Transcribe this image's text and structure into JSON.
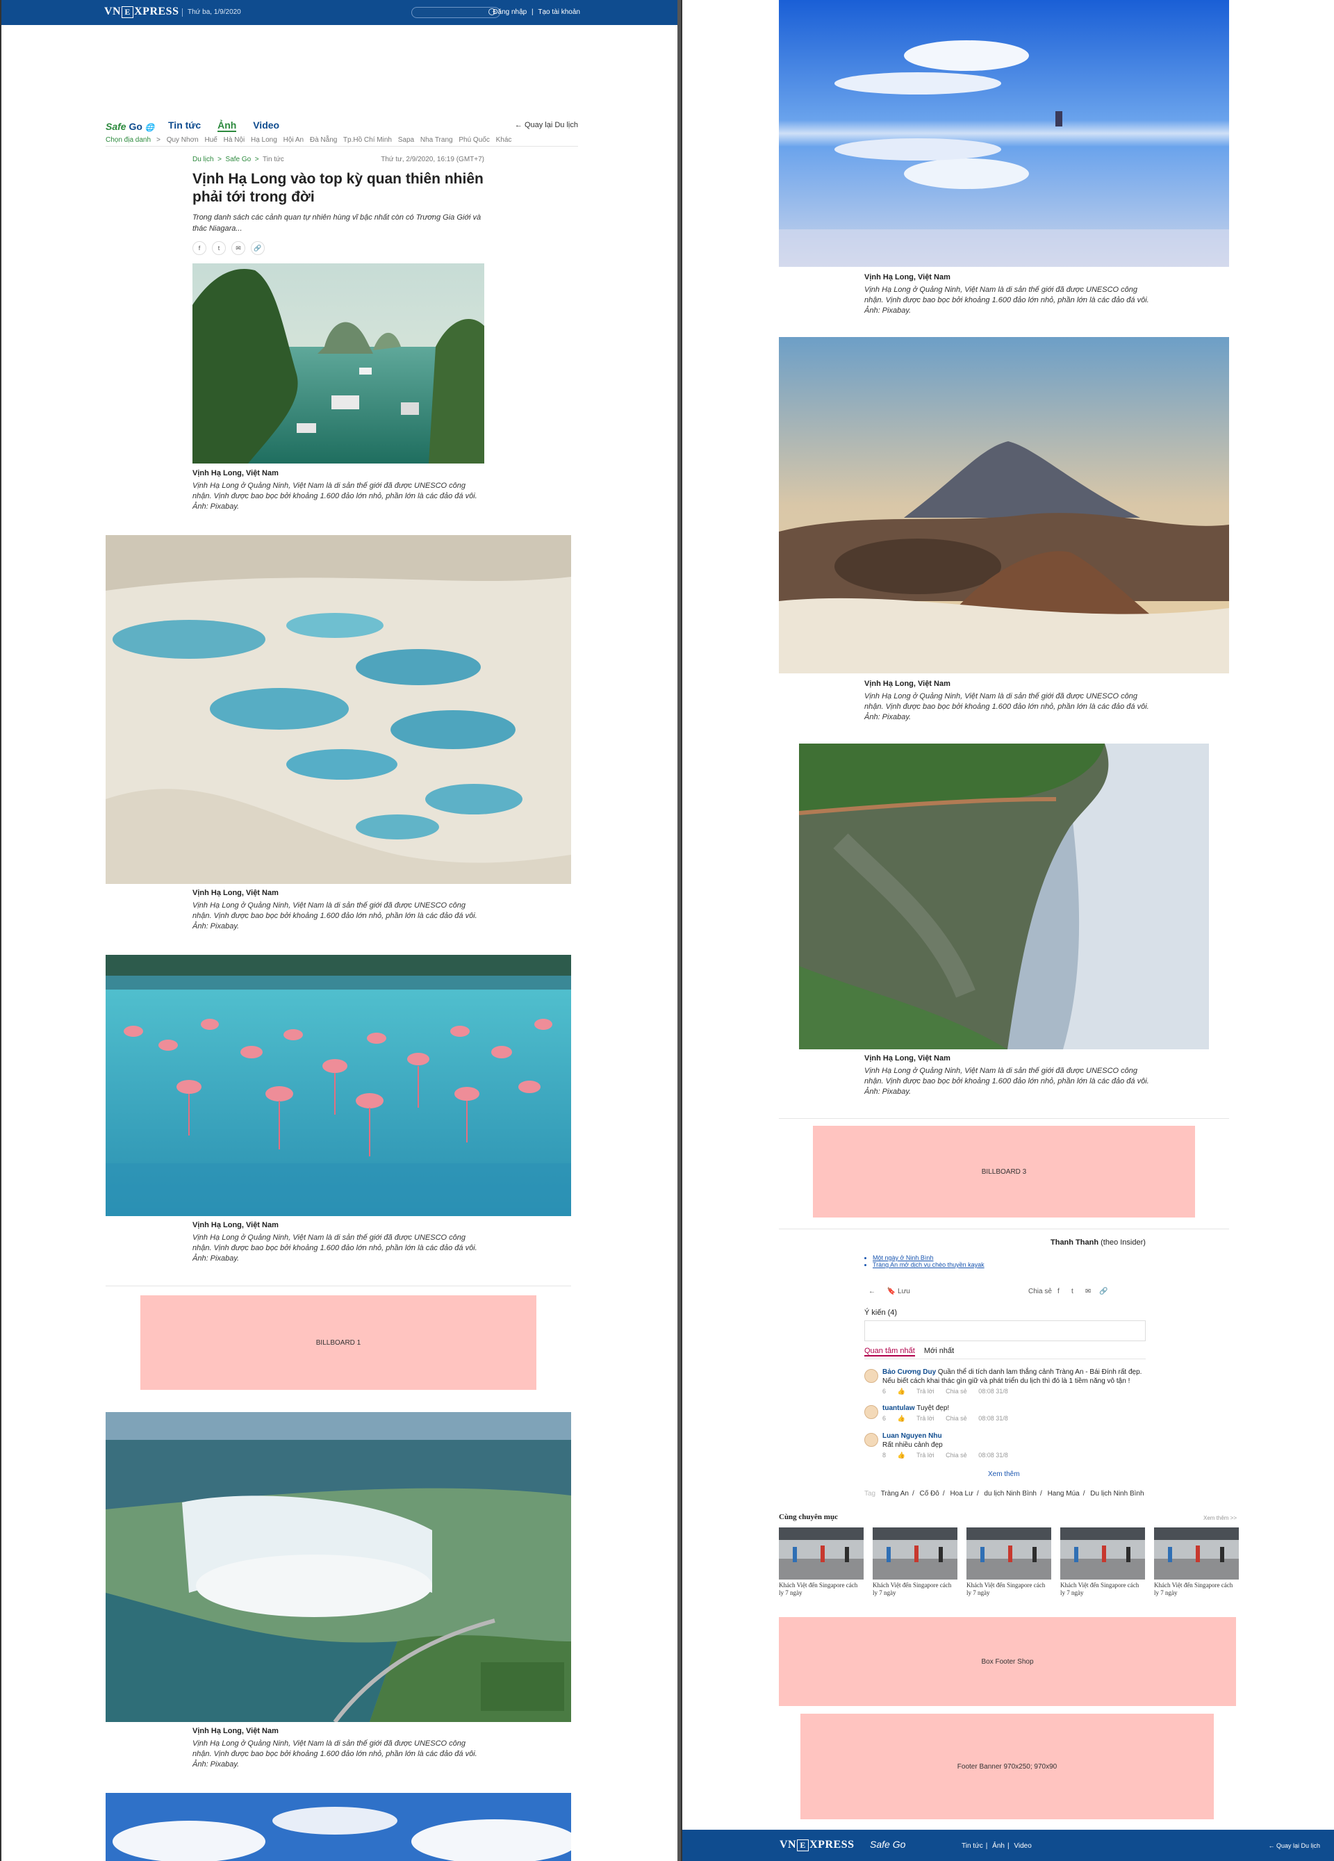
{
  "header": {
    "logo_pre": "VN",
    "logo_box": "E",
    "logo_post": "XPRESS",
    "date": "Thứ ba, 1/9/2020",
    "login": "Đăng nhập",
    "register": "Tạo tài khoản"
  },
  "section": {
    "brand_italic": "Safe",
    "brand_bold": "Go",
    "tabs": [
      "Tin tức",
      "Ảnh",
      "Video"
    ],
    "back": "Quay lại Du lịch",
    "pick_label": "Chọn địa danh",
    "cities": [
      "Quy Nhơn",
      "Huế",
      "Hà Nội",
      "Hạ Long",
      "Hội An",
      "Đà Nẵng",
      "Tp.Hồ Chí Minh",
      "Sapa",
      "Nha Trang",
      "Phú Quốc",
      "Khác"
    ]
  },
  "article": {
    "breadcrumb": [
      "Du lịch",
      "Safe Go",
      "Tin tức"
    ],
    "meta": "Thứ tư, 2/9/2020, 16:19 (GMT+7)",
    "title": "Vịnh Hạ Long vào top kỳ quan thiên nhiên phải tới trong đời",
    "lead": "Trong danh sách các cảnh quan tự nhiên hùng vĩ bậc nhất còn có Trương Gia Giới và thác Niagara...",
    "caption_title": "Vịnh Hạ Long, Việt Nam",
    "caption_desc": "Vịnh Hạ Long ở Quảng Ninh, Việt Nam là di sản thế giới đã được UNESCO công nhận. Vịnh được bao bọc bởi khoảng 1.600 đảo lớn nhỏ, phần lớn là các đảo đá vôi. Ảnh: Pixabay."
  },
  "ads": {
    "billboard1": "BILLBOARD 1",
    "billboard3": "BILLBOARD 3",
    "box_footer_shop": "Box Footer Shop",
    "footer_banner": "Footer Banner 970x250; 970x90"
  },
  "author": {
    "name": "Thanh Thanh",
    "source": "(theo Insider)"
  },
  "related": [
    "Một ngày ở Ninh Bình",
    "Tràng An mở dịch vụ chèo thuyền kayak"
  ],
  "toolbar": {
    "save": "Lưu",
    "share": "Chia sẻ"
  },
  "comments": {
    "title": "Ý kiến (4)",
    "tab_top": "Quan tâm nhất",
    "tab_new": "Mới nhất",
    "reply": "Trả lời",
    "share": "Chia sẻ",
    "items": [
      {
        "name": "Bảo Cương Duy",
        "text": "Quần thể di tích danh lam thắng cảnh Tràng An - Bái Đính rất đẹp. Nếu biết cách khai thác gìn giữ và phát triển du lịch thì đó là 1 tiềm năng vô tận !",
        "likes": "6",
        "time": "08:08 31/8"
      },
      {
        "name": "tuantulaw",
        "text": "Tuyệt đẹp!",
        "likes": "6",
        "time": "08:08 31/8"
      },
      {
        "name": "Luan Nguyen Nhu",
        "text": "Rất nhiều cảnh đẹp",
        "likes": "8",
        "time": "08:08 31/8"
      }
    ],
    "more": "Xem thêm"
  },
  "tags": {
    "label": "Tag",
    "items": [
      "Tràng An",
      "Cố Đô",
      "Hoa Lư",
      "du lịch Ninh Bình",
      "Hang Múa",
      "Du lịch Ninh Bình"
    ]
  },
  "same_category": {
    "title": "Cùng chuyên mục",
    "see_more": "Xem thêm >>",
    "card_title": "Khách Việt đến Singapore cách ly 7 ngày"
  },
  "footer": {
    "links": [
      "Tin tức",
      "Ảnh",
      "Video"
    ],
    "back": "Quay lại Du lịch"
  },
  "colors": {
    "brand_blue": "#0f4c8f",
    "safego_green": "#2d8a3e",
    "ad_pink": "#ffc4c0"
  }
}
